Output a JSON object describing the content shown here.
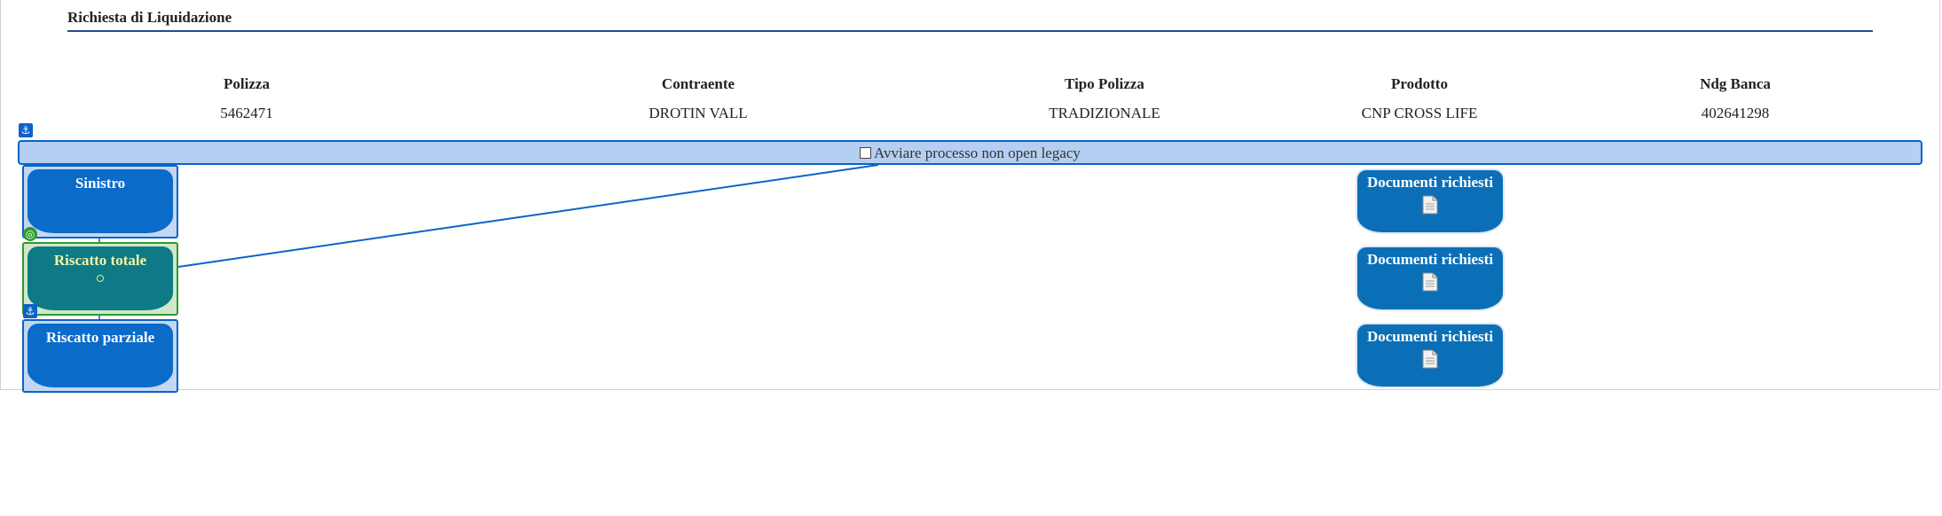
{
  "section": {
    "title": "Richiesta di Liquidazione"
  },
  "policy_columns": [
    {
      "header": "Polizza",
      "value": "5462471"
    },
    {
      "header": "Contraente",
      "value": "DROTIN VALL"
    },
    {
      "header": "Tipo Polizza",
      "value": "TRADIZIONALE"
    },
    {
      "header": "Prodotto",
      "value": "CNP CROSS LIFE"
    },
    {
      "header": "Ndg Banca",
      "value": "402641298"
    }
  ],
  "legacy_option": {
    "label": "Avviare processo non open legacy",
    "checked": false
  },
  "nodes": [
    {
      "label": "Sinistro",
      "selected": false
    },
    {
      "label": "Riscatto totale",
      "selected": true
    },
    {
      "label": "Riscatto parziale",
      "selected": false
    }
  ],
  "documents": [
    {
      "label": "Documenti richiesti",
      "icon": "document-icon"
    },
    {
      "label": "Documenti richiesti",
      "icon": "document-icon"
    },
    {
      "label": "Documenti richiesti",
      "icon": "document-icon"
    }
  ],
  "icons": {
    "anchor": "anchor-icon",
    "target": "target-icon"
  },
  "colors": {
    "accent": "#0b63c9",
    "selected": "#2e9a2e",
    "node": "#0b6bc9",
    "selected_node": "#0d7a86",
    "bar": "#b4cff1"
  }
}
